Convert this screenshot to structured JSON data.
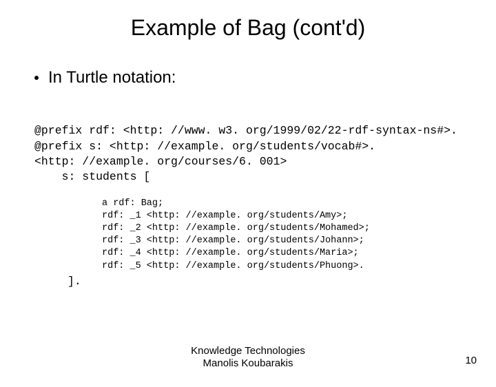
{
  "title": "Example of Bag (cont'd)",
  "bullet": "In Turtle notation:",
  "code": {
    "prefix_rdf": "@prefix rdf: <http: //www. w3. org/1999/02/22-rdf-syntax-ns#>.",
    "prefix_s": "@prefix s: <http: //example. org/students/vocab#>.",
    "subject": "<http: //example. org/courses/6. 001>",
    "students": "    s: students [",
    "a": "a rdf: Bag;",
    "m1": "rdf: _1 <http: //example. org/students/Amy>;",
    "m2": "rdf: _2 <http: //example. org/students/Mohamed>;",
    "m3": "rdf: _3 <http: //example. org/students/Johann>;",
    "m4": "rdf: _4 <http: //example. org/students/Maria>;",
    "m5": "rdf: _5 <http: //example. org/students/Phuong>.",
    "close": "]."
  },
  "footer_line1": "Knowledge Technologies",
  "footer_line2": "Manolis Koubarakis",
  "page_number": "10"
}
